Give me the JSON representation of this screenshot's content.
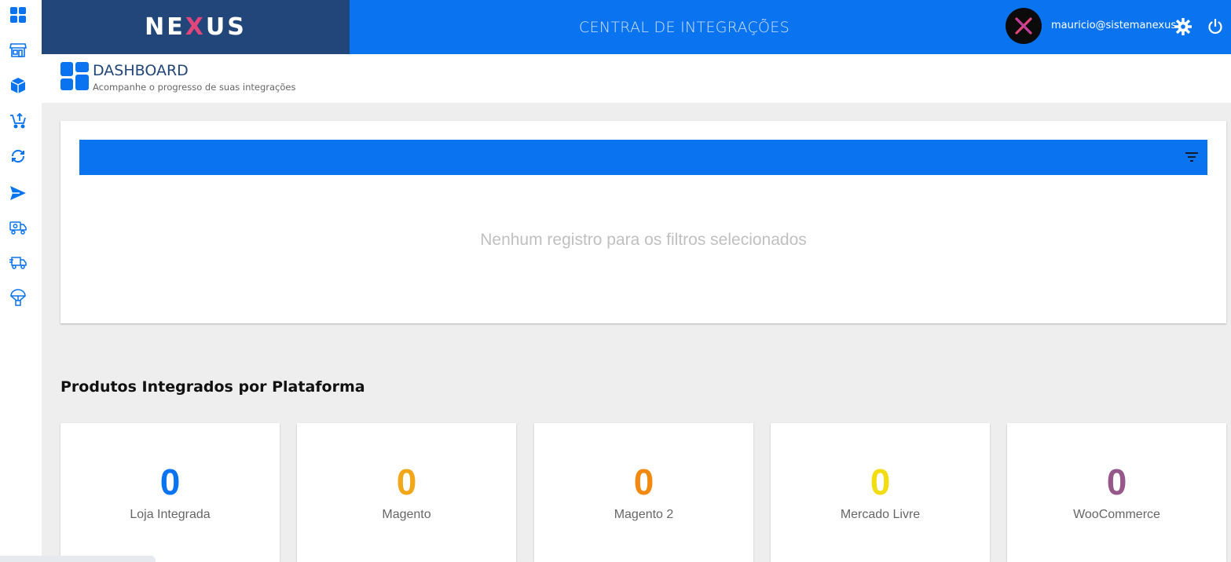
{
  "brand": {
    "logo_pre": "NE",
    "logo_x": "X",
    "logo_post": "US"
  },
  "header": {
    "title": "CENTRAL DE INTEGRAÇÕES",
    "user_email": "mauricio@sistemanexus"
  },
  "page": {
    "title": "DASHBOARD",
    "subtitle": "Acompanhe o progresso de suas integrações"
  },
  "filter": {
    "empty_message": "Nenhum registro para os filtros selecionados"
  },
  "platforms": {
    "title": "Produtos Integrados por Plataforma",
    "items": [
      {
        "value": "0",
        "label": "Loja Integrada",
        "color": "#0a73f0"
      },
      {
        "value": "0",
        "label": "Magento",
        "color": "#f0a81a"
      },
      {
        "value": "0",
        "label": "Magento 2",
        "color": "#f28a12"
      },
      {
        "value": "0",
        "label": "Mercado Livre",
        "color": "#f2dc12"
      },
      {
        "value": "0",
        "label": "WooCommerce",
        "color": "#96588a"
      }
    ]
  },
  "colors": {
    "primary": "#0a73f0",
    "brand_dark": "#23467a"
  },
  "sidebar_icons": [
    "dashboard-icon",
    "store-icon",
    "box-icon",
    "cart-upload-icon",
    "sync-icon",
    "send-icon",
    "truck-money-icon",
    "delivery-truck-icon",
    "parachute-package-icon"
  ]
}
